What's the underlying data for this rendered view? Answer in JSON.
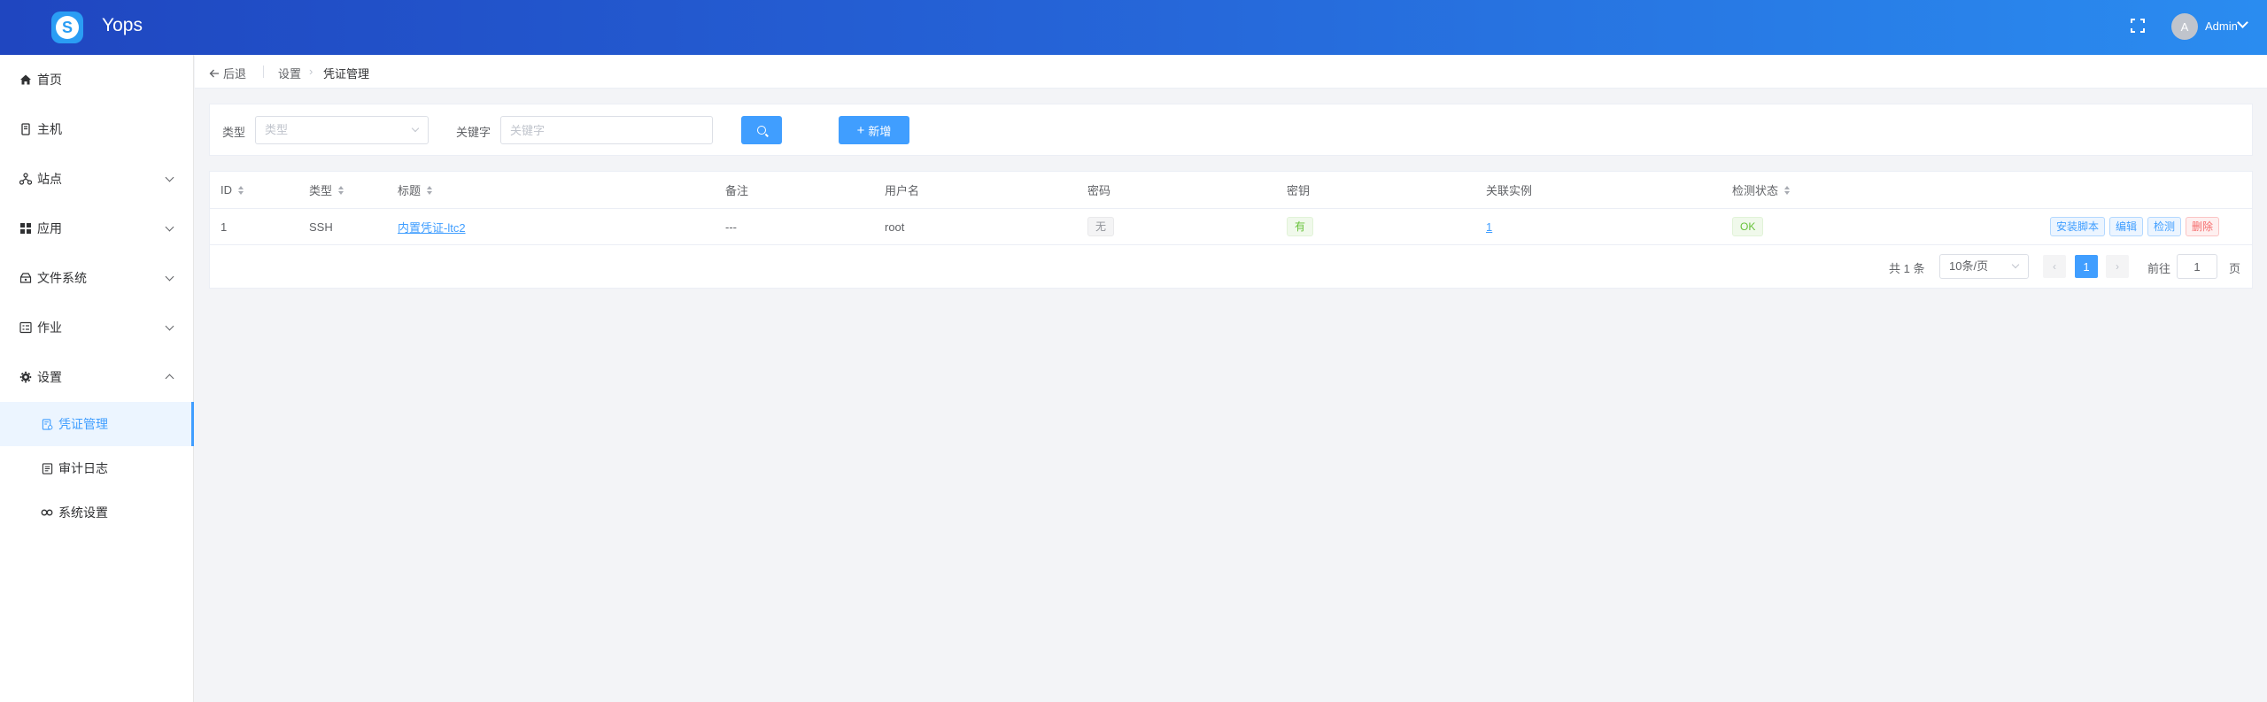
{
  "header": {
    "app_title": "Yops",
    "logo_icon": "logo-icon",
    "user_avatar_letter": "A",
    "user_name": "Admin"
  },
  "sidebar": {
    "items": [
      {
        "label": "首页",
        "icon": "home-icon"
      },
      {
        "label": "主机",
        "icon": "host-icon"
      },
      {
        "label": "站点",
        "icon": "site-icon"
      },
      {
        "label": "应用",
        "icon": "app-icon"
      },
      {
        "label": "文件系统",
        "icon": "filesystem-icon"
      },
      {
        "label": "作业",
        "icon": "job-icon"
      },
      {
        "label": "设置",
        "icon": "gear-icon"
      }
    ],
    "sub_items": [
      {
        "label": "凭证管理",
        "icon": "credential-icon",
        "active": true
      },
      {
        "label": "审计日志",
        "icon": "audit-log-icon"
      },
      {
        "label": "系统设置",
        "icon": "system-settings-icon"
      }
    ]
  },
  "breadcrumb": {
    "back": "后退",
    "level1": "设置",
    "level2": "凭证管理"
  },
  "filter": {
    "type_label": "类型",
    "type_placeholder": "类型",
    "keyword_label": "关键字",
    "keyword_placeholder": "关键字",
    "add_label": "新增"
  },
  "table": {
    "columns": [
      "ID",
      "类型",
      "标题",
      "备注",
      "用户名",
      "密码",
      "密钥",
      "关联实例",
      "检测状态"
    ],
    "rows": [
      {
        "id": "1",
        "type": "SSH",
        "title": "内置凭证-ltc2",
        "remark": "---",
        "username": "root",
        "password": "无",
        "key": "有",
        "linked": "1",
        "status": "OK",
        "actions": [
          "安装脚本",
          "编辑",
          "检测",
          "删除"
        ]
      }
    ]
  },
  "pagination": {
    "total": "共 1 条",
    "page_size": "10条/页",
    "current": "1",
    "goto_label": "前往",
    "goto_value": "1",
    "page_suffix": "页"
  },
  "colors": {
    "primary": "#409eff",
    "header_start": "#1f46c0",
    "header_end": "#2a8cf0",
    "danger": "#f56c6c",
    "success": "#67c23a"
  }
}
